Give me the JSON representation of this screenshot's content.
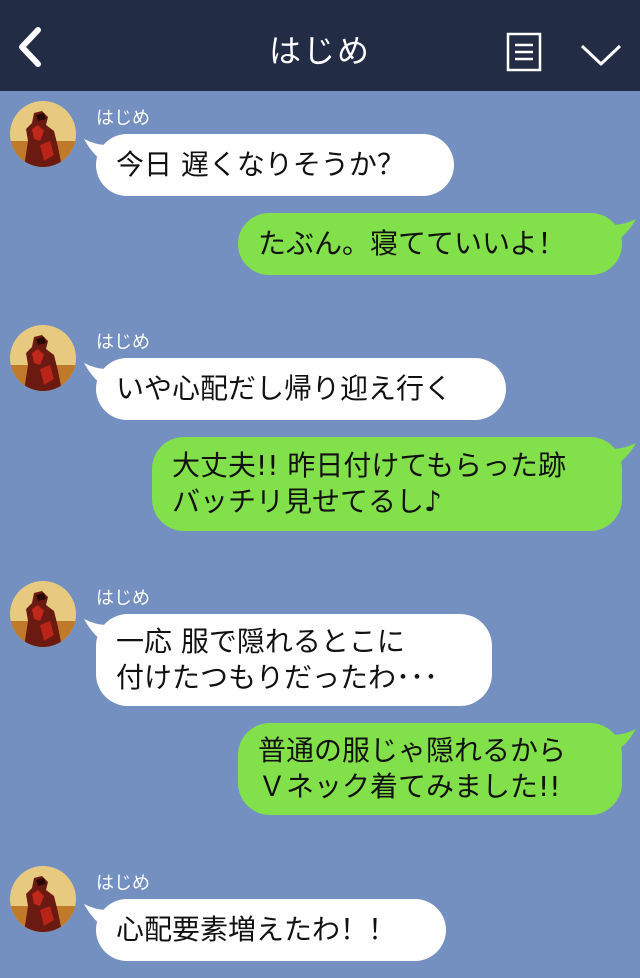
{
  "header": {
    "title": "はじめ",
    "back_icon": "chevron-left-icon",
    "menu_icon": "list-menu-icon",
    "collapse_icon": "chevron-down-icon"
  },
  "colors": {
    "header_bg": "#222c44",
    "chat_bg": "#7490c0",
    "incoming_bubble": "#ffffff",
    "outgoing_bubble": "#82e04a"
  },
  "messages": [
    {
      "direction": "in",
      "sender": "はじめ",
      "lines": [
        "今日 遅くなりそうか？"
      ]
    },
    {
      "direction": "out",
      "lines": [
        "たぶん。寝てていいよ！"
      ]
    },
    {
      "direction": "in",
      "sender": "はじめ",
      "lines": [
        "いや心配だし帰り迎え行く"
      ]
    },
    {
      "direction": "out",
      "lines": [
        "大丈夫!! 昨日付けてもらった跡",
        "バッチリ見せてるし♪"
      ]
    },
    {
      "direction": "in",
      "sender": "はじめ",
      "lines": [
        "一応 服で隠れるとこに",
        "付けたつもりだったわ･･･"
      ]
    },
    {
      "direction": "out",
      "lines": [
        "普通の服じゃ隠れるから",
        "Ｖネック着てみました!!"
      ]
    },
    {
      "direction": "in",
      "sender": "はじめ",
      "lines": [
        "心配要素増えたわ！！"
      ]
    }
  ]
}
